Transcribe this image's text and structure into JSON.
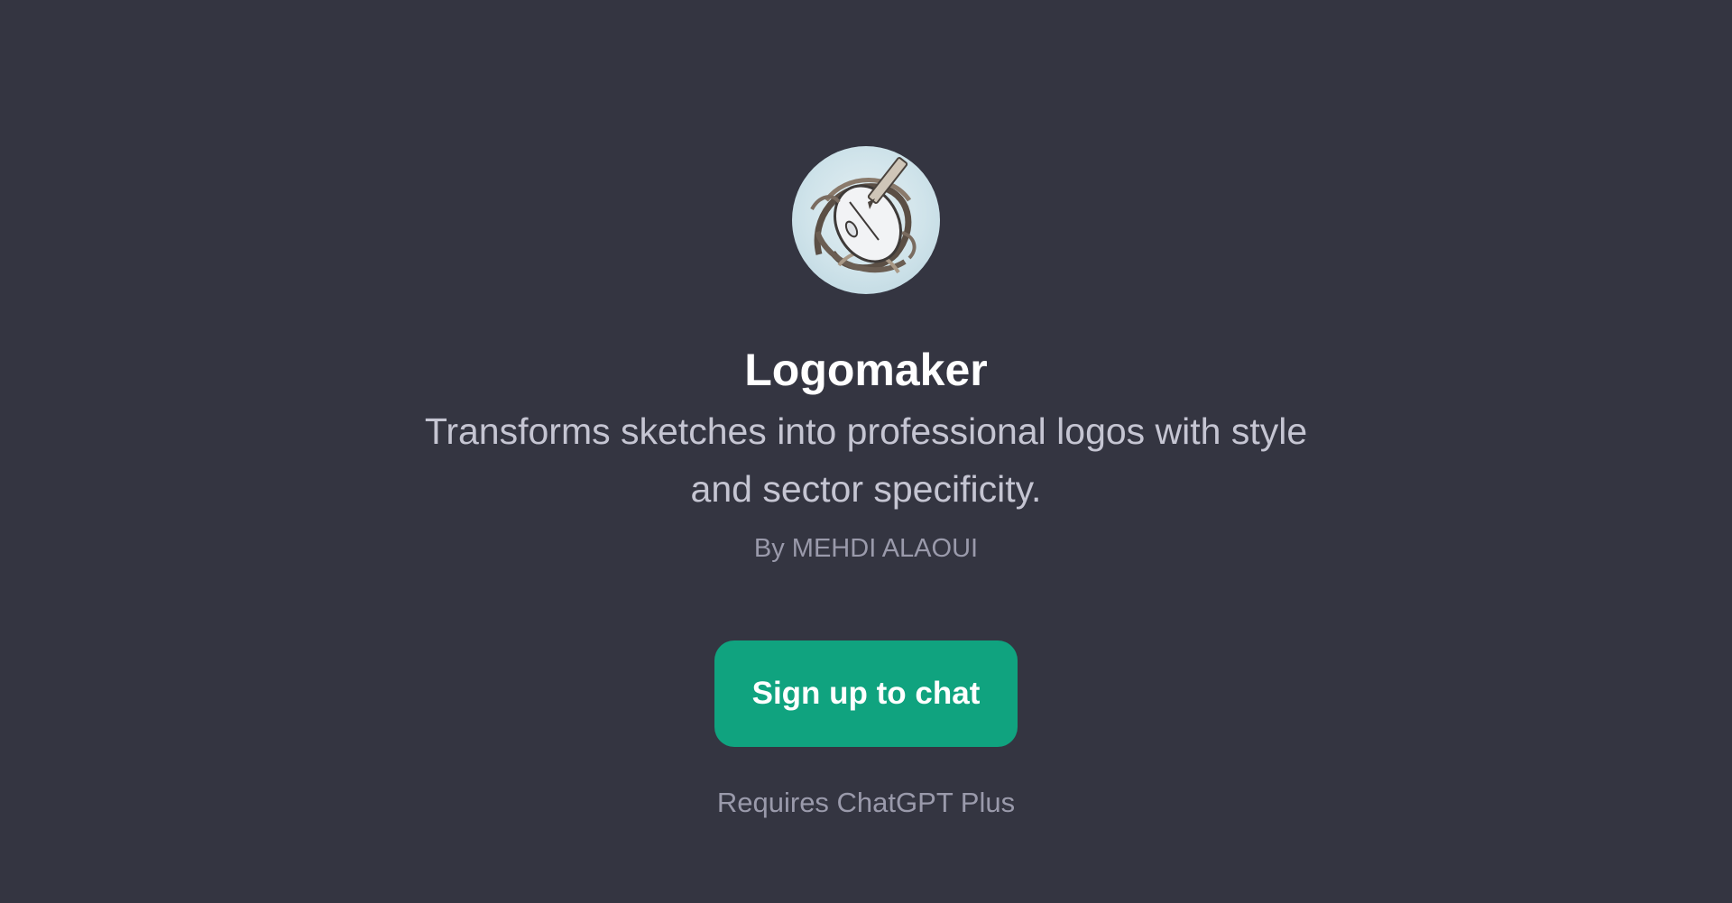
{
  "gpt": {
    "icon": "logo-sketch-avatar",
    "name": "Logomaker",
    "description": "Transforms sketches into professional logos with style and sector specificity.",
    "author": "By MEHDI ALAOUI"
  },
  "cta": {
    "label": "Sign up to chat",
    "note": "Requires ChatGPT Plus"
  },
  "colors": {
    "background": "#343541",
    "button": "#10a37f",
    "title": "#ffffff",
    "description": "#c5c5d2",
    "muted": "#9a9aab"
  }
}
